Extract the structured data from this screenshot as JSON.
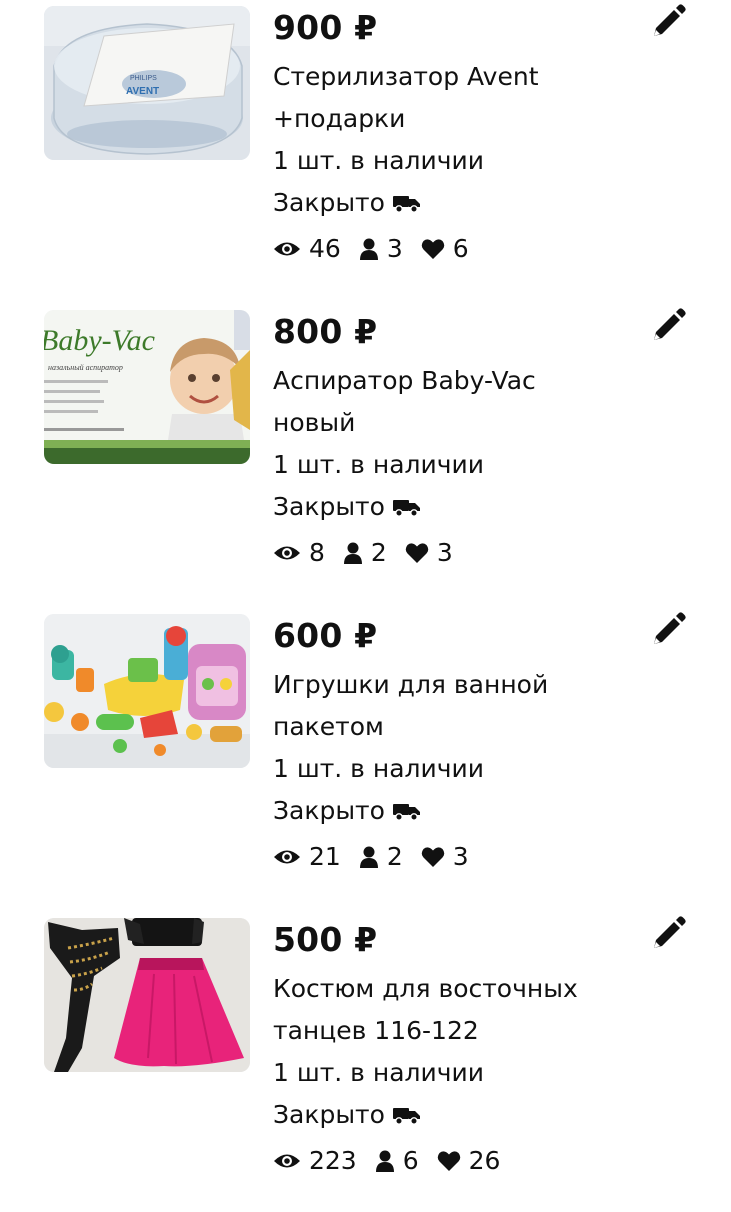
{
  "listings": [
    {
      "price": "900 ₽",
      "title_line1": "Стерилизатор Avent",
      "title_line2": "+подарки",
      "stock": "1 шт. в наличии",
      "status": "Закрыто",
      "views": "46",
      "contacts": "3",
      "likes": "6",
      "image": "avent-sterilizer"
    },
    {
      "price": "800 ₽",
      "title_line1": "Аспиратор Baby-Vac",
      "title_line2": "новый",
      "stock": "1 шт. в наличии",
      "status": "Закрыто",
      "views": "8",
      "contacts": "2",
      "likes": "3",
      "image": "baby-vac-box"
    },
    {
      "price": "600 ₽",
      "title_line1": "Игрушки для ванной",
      "title_line2": "пакетом",
      "stock": "1 шт. в наличии",
      "status": "Закрыто",
      "views": "21",
      "contacts": "2",
      "likes": "3",
      "image": "bath-toys"
    },
    {
      "price": "500 ₽",
      "title_line1": "Костюм для восточных",
      "title_line2": "танцев 116-122",
      "stock": "1 шт. в наличии",
      "status": "Закрыто",
      "views": "223",
      "contacts": "6",
      "likes": "26",
      "image": "belly-dance-costume"
    }
  ],
  "icons": {
    "edit": "pencil-icon",
    "delivery": "truck-icon",
    "views": "eye-icon",
    "contacts": "person-icon",
    "likes": "heart-icon"
  },
  "image_text": {
    "philips": "PHILIPS",
    "avent": "AVENT",
    "babyvac": "Baby-Vac",
    "aspirator": "назальный аспиратор"
  }
}
